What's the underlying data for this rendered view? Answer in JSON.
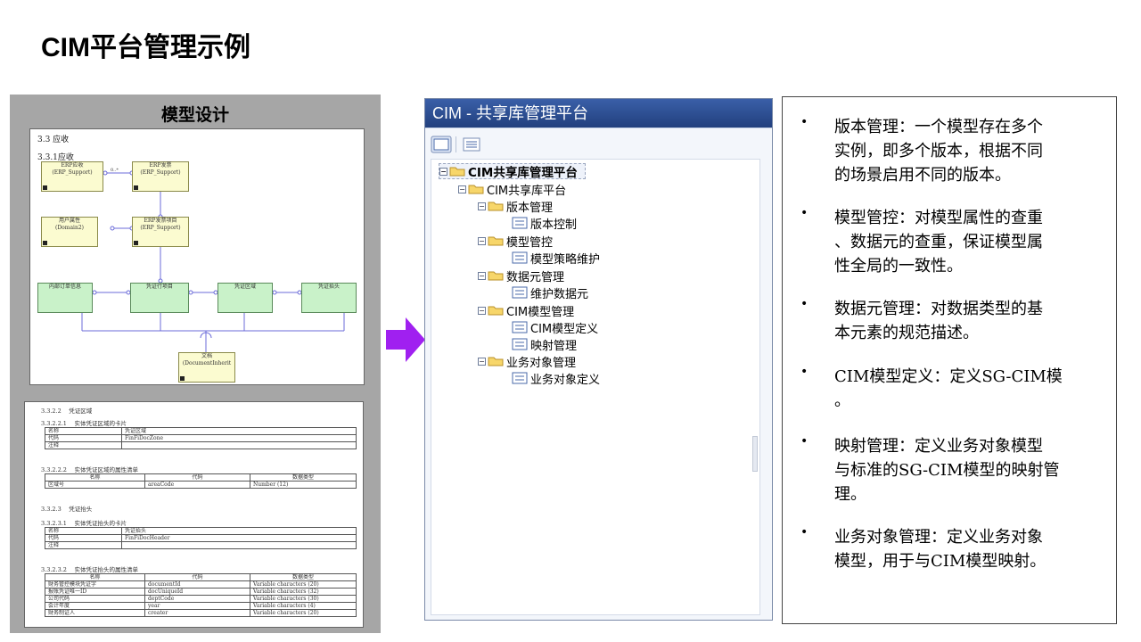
{
  "slide": {
    "title": "CIM平台管理示例"
  },
  "left_panel": {
    "title": "模型设计",
    "uml": {
      "section": "3.3 应收",
      "subsection": "3.3.1应收",
      "multiplicity": "0..*",
      "classes": [
        {
          "id": "c1",
          "line1": "ERP应收",
          "line2": "(ERP_Support)"
        },
        {
          "id": "c2",
          "line1": "ERP发票",
          "line2": "(ERP_Support)"
        },
        {
          "id": "c3",
          "line1": "用户属性",
          "line2": "(Domain2)"
        },
        {
          "id": "c4",
          "line1": "ERP发票项目",
          "line2": "(ERP_Support)"
        },
        {
          "id": "c5",
          "line1": "内部订单信息",
          "line2": ""
        },
        {
          "id": "c6",
          "line1": "凭证行项目",
          "line2": ""
        },
        {
          "id": "c7",
          "line1": "凭证区域",
          "line2": ""
        },
        {
          "id": "c8",
          "line1": "凭证抬头",
          "line2": ""
        },
        {
          "id": "c9",
          "line1": "文档",
          "line2": "(DocumentInherit"
        }
      ]
    },
    "doc": {
      "h1": "3.3.2.2　 凭证区域",
      "h2": "3.3.2.2.1　 实体凭证区域的卡片",
      "card1": [
        [
          "名称",
          "凭证区域"
        ],
        [
          "代码",
          "FinFiDocZone"
        ],
        [
          "注释",
          ""
        ]
      ],
      "h3": "3.3.2.2.2　 实体凭证区域的属性清单",
      "attr1_header": [
        "名称",
        "代码",
        "数据类型"
      ],
      "attr1_rows": [
        [
          "区域号",
          "areaCode",
          "Number (12)"
        ]
      ],
      "h4": "3.3.2.3　 凭证抬头",
      "h5": "3.3.2.3.1　 实体凭证抬头的卡片",
      "card2": [
        [
          "名称",
          "凭证抬头"
        ],
        [
          "代码",
          "FinFiDocHeader"
        ],
        [
          "注释",
          ""
        ]
      ],
      "h6": "3.3.2.3.2　 实体凭证抬头的属性清单",
      "attr2_header": [
        "名称",
        "代码",
        "数据类型"
      ],
      "attr2_rows": [
        [
          "财务管控模块凭证字",
          "documentId",
          "Variable characters (20)"
        ],
        [
          "报账凭证唯一ID",
          "docUniqueId",
          "Variable characters (32)"
        ],
        [
          "公司代码",
          "deptCode",
          "Variable characters (30)"
        ],
        [
          "会计年度",
          "year",
          "Variable characters (4)"
        ],
        [
          "财务制证人",
          "creater",
          "Variable characters (20)"
        ]
      ]
    }
  },
  "window": {
    "title": "CIM - 共享库管理平台",
    "tree": {
      "root": "CIM共享库管理平台",
      "platform": "CIM共享库平台",
      "groups": [
        {
          "label": "版本管理",
          "items": [
            "版本控制"
          ]
        },
        {
          "label": "模型管控",
          "items": [
            "模型策略维护"
          ]
        },
        {
          "label": "数据元管理",
          "items": [
            "维护数据元"
          ]
        },
        {
          "label": "CIM模型管理",
          "items": [
            "CIM模型定义",
            "映射管理"
          ]
        },
        {
          "label": "业务对象管理",
          "items": [
            "业务对象定义"
          ]
        }
      ]
    }
  },
  "bullets": [
    {
      "line1": "版本管理：一个模型存在多个",
      "line2": "实例，即多个版本，根据不同",
      "line3": "的场景启用不同的版本。"
    },
    {
      "line1": "模型管控：对模型属性的查重",
      "line2": "、数据元的查重，保证模型属",
      "line3": "性全局的一致性。"
    },
    {
      "line1": "数据元管理：对数据类型的基",
      "line2": "本元素的规范描述。",
      "line3": ""
    },
    {
      "line1": "CIM模型定义：定义SG-CIM模",
      "line2": "。",
      "line3": ""
    },
    {
      "line1": "映射管理：定义业务对象模型",
      "line2": "与标准的SG-CIM模型的映射管",
      "line3": "理。"
    },
    {
      "line1": "业务对象管理：定义业务对象",
      "line2": "模型，用于与CIM模型映射。",
      "line3": ""
    }
  ],
  "colors": {
    "arrow": "#a020f0",
    "window_title": "#2b4a8c",
    "uml_yellow": "#fbfbd0",
    "uml_green": "#c9f2c9",
    "uml_line": "#6b6bd9"
  }
}
